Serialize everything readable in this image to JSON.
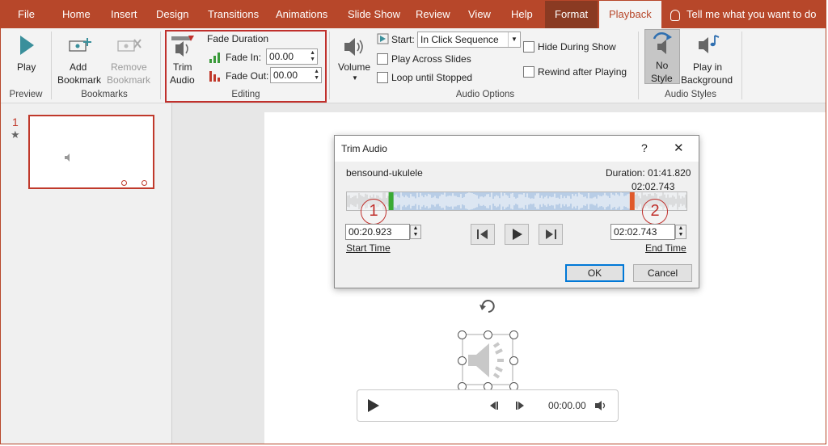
{
  "tabs": [
    "File",
    "Home",
    "Insert",
    "Design",
    "Transitions",
    "Animations",
    "Slide Show",
    "Review",
    "View",
    "Help",
    "Format",
    "Playback"
  ],
  "tell_me": "Tell me what you want to do",
  "ribbon": {
    "play": "Play",
    "add_bookmark_1": "Add",
    "add_bookmark_2": "Bookmark",
    "remove_bookmark_1": "Remove",
    "remove_bookmark_2": "Bookmark",
    "trim_1": "Trim",
    "trim_2": "Audio",
    "fade_duration": "Fade Duration",
    "fade_in_label": "Fade In:",
    "fade_in_value": "00.00",
    "fade_out_label": "Fade Out:",
    "fade_out_value": "00.00",
    "volume": "Volume",
    "start_label": "Start:",
    "start_value": "In Click Sequence",
    "play_across": "Play Across Slides",
    "loop": "Loop until Stopped",
    "hide": "Hide During Show",
    "rewind": "Rewind after Playing",
    "no_style_1": "No",
    "no_style_2": "Style",
    "play_bg_1": "Play in",
    "play_bg_2": "Background",
    "groups": {
      "preview": "Preview",
      "bookmarks": "Bookmarks",
      "editing": "Editing",
      "audio_options": "Audio Options",
      "audio_styles": "Audio Styles"
    }
  },
  "slide_panel": {
    "number": "1",
    "star": "★"
  },
  "dialog": {
    "title": "Trim Audio",
    "help": "?",
    "close": "✕",
    "filename": "bensound-ukulele",
    "duration": "Duration: 01:41.820",
    "marker_time": "02:02.743",
    "start_time": "00:20.923",
    "start_label": "Start Time",
    "end_time": "02:02.743",
    "end_label": "End Time",
    "ok": "OK",
    "cancel": "Cancel",
    "callout_1": "1",
    "callout_2": "2",
    "start_marker_fraction": 0.13,
    "end_marker_fraction": 0.84
  },
  "player": {
    "time": "00:00.00"
  },
  "colors": {
    "accent": "#b7472a",
    "highlight": "#c0302c",
    "start_marker": "#3aaa35",
    "end_marker": "#e05a2b",
    "waveform": "#b8cde6"
  }
}
